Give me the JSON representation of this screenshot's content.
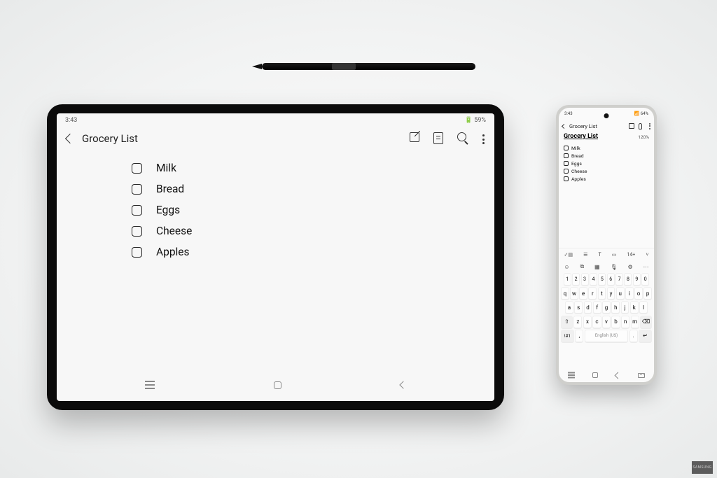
{
  "tablet": {
    "status": {
      "time": "3:43",
      "battery": "🔋 59%"
    },
    "header": {
      "title": "Grocery List"
    },
    "items": [
      {
        "label": "Milk"
      },
      {
        "label": "Bread"
      },
      {
        "label": "Eggs"
      },
      {
        "label": "Cheese"
      },
      {
        "label": "Apples"
      }
    ]
  },
  "phone": {
    "status": {
      "time": "3:43",
      "battery": "📶 64%"
    },
    "header": {
      "title": "Grocery List"
    },
    "note_title": "Grocery List",
    "zoom": "120%",
    "items": [
      {
        "label": "Milk"
      },
      {
        "label": "Bread"
      },
      {
        "label": "Eggs"
      },
      {
        "label": "Cheese"
      },
      {
        "label": "Apples"
      }
    ],
    "toolbar_top": [
      "✓▤",
      "☰",
      "T",
      "▭",
      "14+",
      "˅"
    ],
    "toolbar_mid": [
      "☺",
      "⧉",
      "▦",
      "🎙",
      "⚙",
      "⋯"
    ],
    "keyboard": {
      "numbers": [
        "1",
        "2",
        "3",
        "4",
        "5",
        "6",
        "7",
        "8",
        "9",
        "0"
      ],
      "row1": [
        "q",
        "w",
        "e",
        "r",
        "t",
        "y",
        "u",
        "i",
        "o",
        "p"
      ],
      "row2": [
        "a",
        "s",
        "d",
        "f",
        "g",
        "h",
        "j",
        "k",
        "l"
      ],
      "row3": [
        "z",
        "x",
        "c",
        "v",
        "b",
        "n",
        "m"
      ],
      "shift": "⇧",
      "backspace": "⌫",
      "symbols": "!#1",
      "comma": ",",
      "space_label": "English (US)",
      "period": ".",
      "enter": "↵"
    }
  },
  "watermark": "SAMSUNG"
}
